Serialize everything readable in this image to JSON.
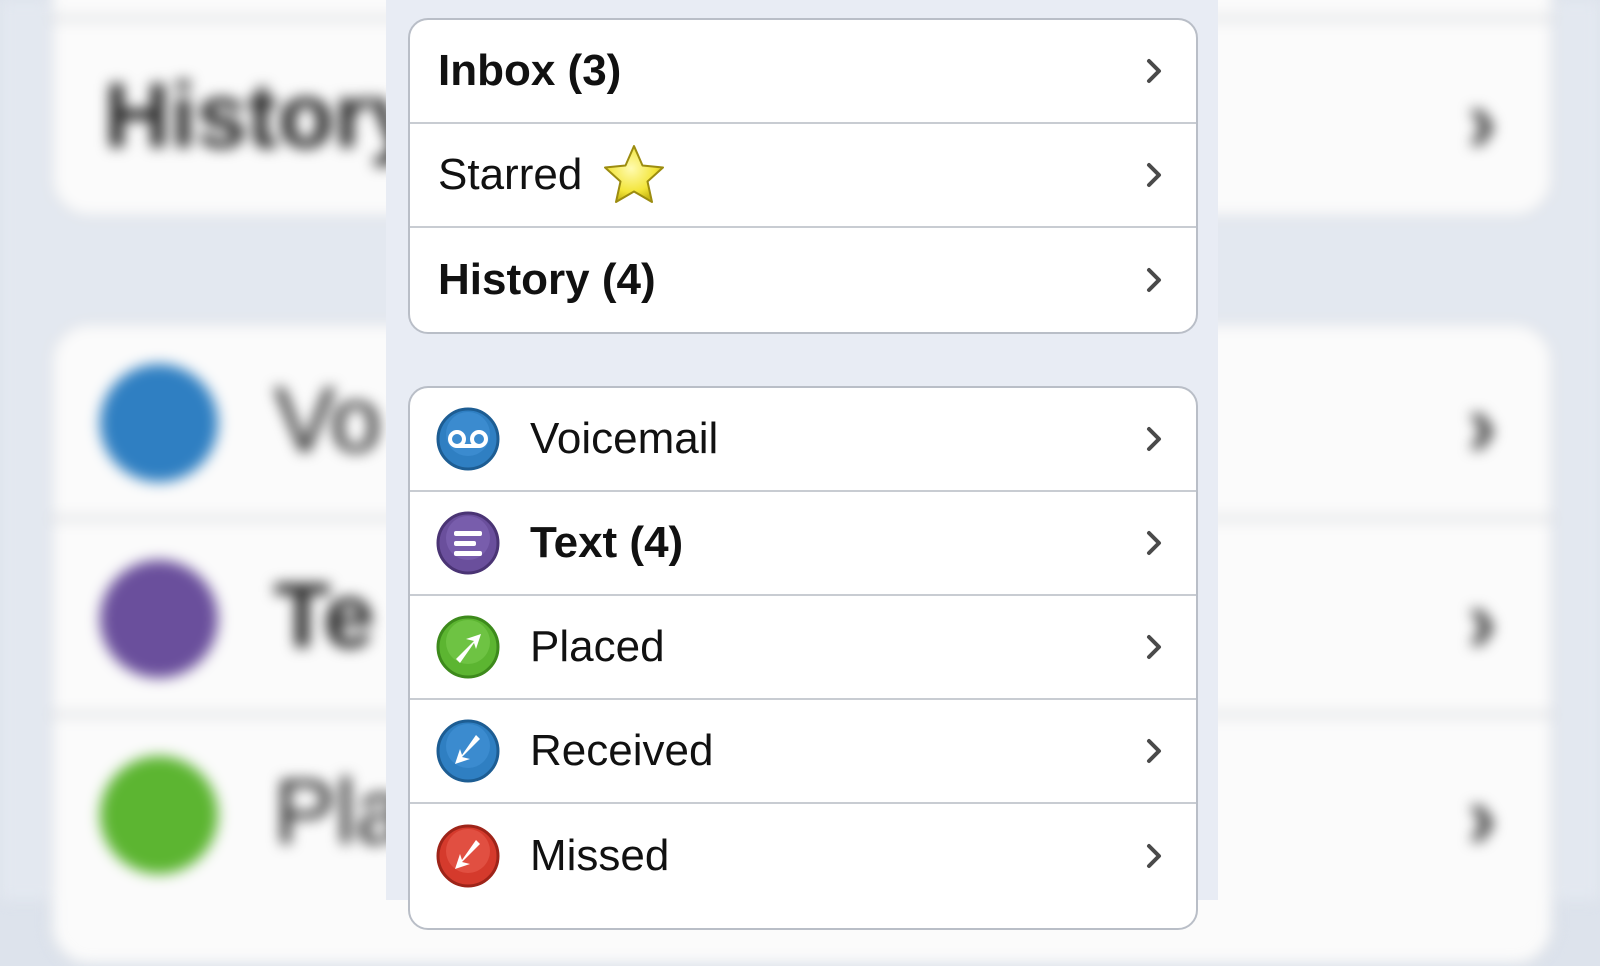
{
  "top_group": {
    "inbox": {
      "label": "Inbox (3)"
    },
    "starred": {
      "label": "Starred",
      "icon": "star-icon",
      "icon_color": "#f3e53a"
    },
    "history": {
      "label": "History (4)"
    }
  },
  "calls_group": {
    "voicemail": {
      "label": "Voicemail",
      "icon": "voicemail-icon",
      "icon_color": "#2f7fc2"
    },
    "text": {
      "label": "Text (4)",
      "icon": "text-message-icon",
      "icon_color": "#6a4f9c"
    },
    "placed": {
      "label": "Placed",
      "icon": "placed-call-icon",
      "icon_color": "#5cb531"
    },
    "received": {
      "label": "Received",
      "icon": "received-call-icon",
      "icon_color": "#2f7fc2"
    },
    "missed": {
      "label": "Missed",
      "icon": "missed-call-icon",
      "icon_color": "#d53a2c"
    }
  },
  "background": {
    "history_fragment": "History",
    "voicemail_fragment": "Vo",
    "text_fragment": "Te",
    "placed_fragment": "Pla"
  },
  "colors": {
    "page_background": "#e8ecf4",
    "row_background": "#ffffff",
    "separator": "#c8ccd2"
  }
}
